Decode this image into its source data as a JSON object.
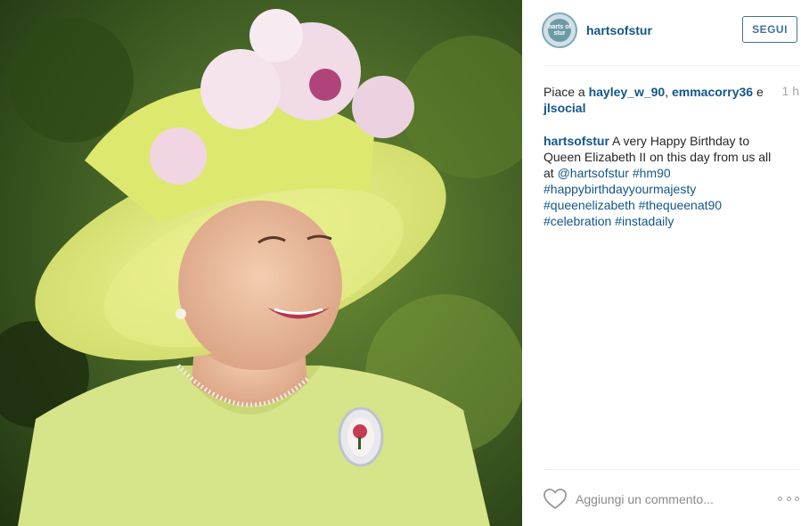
{
  "post": {
    "username": "hartsofstur",
    "avatar_text": "harts of stur",
    "follow_label": "SEGUI",
    "likes": {
      "prefix": "Piace a",
      "user1": "hayley_w_90",
      "separator": ",",
      "user2": "emmacorry36",
      "conjunction": "e",
      "user3": "jlsocial"
    },
    "time": "1 h",
    "caption": {
      "author": "hartsofstur",
      "text": "A very Happy Birthday to Queen Elizabeth II on this day from us all at",
      "mention": "@hartsofstur",
      "tags": [
        "#hm90",
        "#happybirthdayyourmajesty",
        "#queenelizabeth",
        "#thequeenat90",
        "#celebration",
        "#instadaily"
      ]
    },
    "comment_placeholder": "Aggiungi un commento...",
    "like_icon": "heart-outline-icon",
    "more_icon": "more-options-icon"
  },
  "colors": {
    "link": "#125688",
    "button": "#3f729b",
    "muted": "#a5a7aa"
  }
}
